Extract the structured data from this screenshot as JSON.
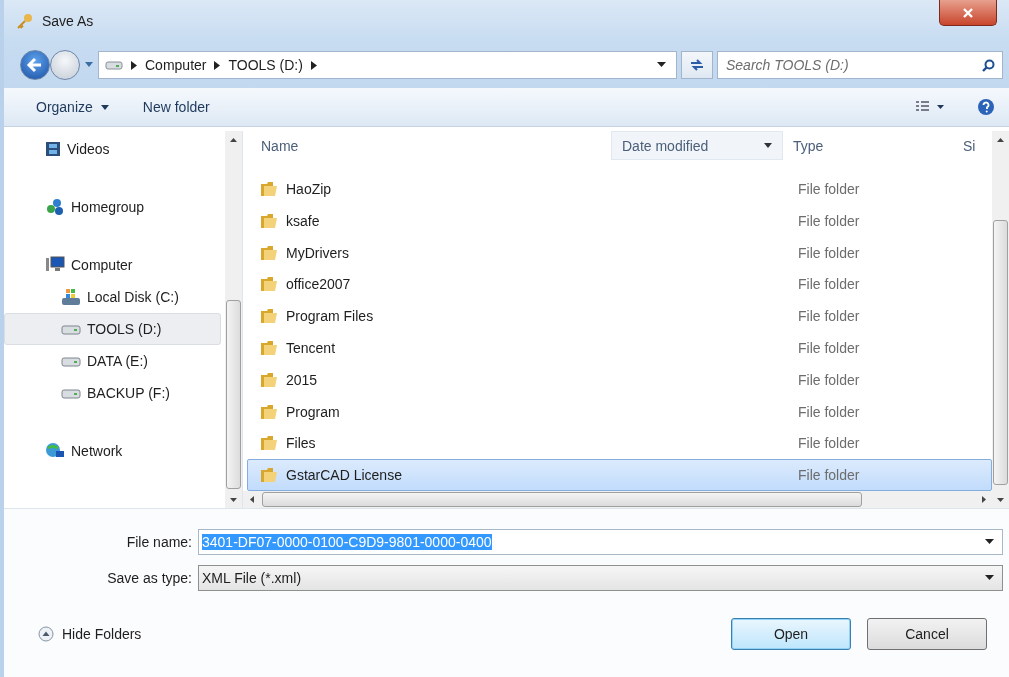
{
  "window": {
    "title": "Save As"
  },
  "address": {
    "crumbs": [
      "Computer",
      "TOOLS (D:)"
    ]
  },
  "search": {
    "placeholder": "Search TOOLS (D:)"
  },
  "toolbar": [
    {
      "label": "Organize",
      "dropdown": true
    },
    {
      "label": "New folder",
      "dropdown": false
    }
  ],
  "sidebar": {
    "items": [
      {
        "label": "Videos",
        "kind": "video",
        "selected": false
      },
      {
        "label": "Homegroup",
        "kind": "homegroup",
        "selected": false
      },
      {
        "label": "Computer",
        "kind": "computer",
        "selected": false,
        "children": [
          {
            "label": "Local Disk (C:)",
            "kind": "system-drive",
            "selected": false
          },
          {
            "label": "TOOLS (D:)",
            "kind": "drive",
            "selected": true
          },
          {
            "label": "DATA (E:)",
            "kind": "drive",
            "selected": false
          },
          {
            "label": "BACKUP (F:)",
            "kind": "drive",
            "selected": false
          }
        ]
      },
      {
        "label": "Network",
        "kind": "network",
        "selected": false
      }
    ]
  },
  "table": {
    "columns": [
      "Name",
      "Date modified",
      "Type",
      "Si"
    ],
    "rows": [
      {
        "name": "HaoZip",
        "type": "File folder",
        "selected": false
      },
      {
        "name": "ksafe",
        "type": "File folder",
        "selected": false
      },
      {
        "name": "MyDrivers",
        "type": "File folder",
        "selected": false
      },
      {
        "name": "office2007",
        "type": "File folder",
        "selected": false
      },
      {
        "name": "Program Files",
        "type": "File folder",
        "selected": false
      },
      {
        "name": "Tencent",
        "type": "File folder",
        "selected": false
      },
      {
        "name": "2015",
        "type": "File folder",
        "selected": false
      },
      {
        "name": "Program",
        "type": "File folder",
        "selected": false
      },
      {
        "name": "Files",
        "type": "File folder",
        "selected": false
      },
      {
        "name": "GstarCAD License",
        "type": "File folder",
        "selected": true
      }
    ]
  },
  "file_name": {
    "label": "File name:",
    "value": "3401-DF07-0000-0100-C9D9-9801-0000-0400",
    "selected": true
  },
  "save_type": {
    "label": "Save as type:",
    "value": "XML File (*.xml)"
  },
  "hide_folders": {
    "label": "Hide Folders"
  },
  "buttons": [
    {
      "label": "Open",
      "default": true
    },
    {
      "label": "Cancel",
      "default": false
    }
  ]
}
